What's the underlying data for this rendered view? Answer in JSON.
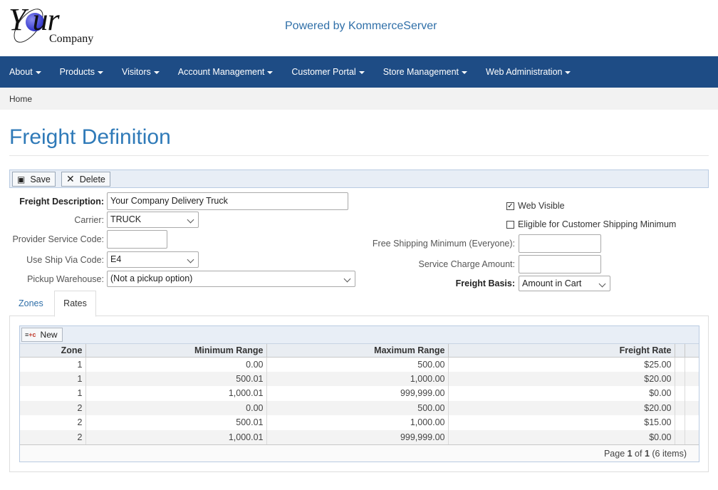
{
  "header": {
    "logo_main": "Y ur",
    "logo_sub": "Company",
    "powered_by": "Powered by KommerceServer"
  },
  "nav": {
    "items": [
      {
        "label": "About"
      },
      {
        "label": "Products"
      },
      {
        "label": "Visitors"
      },
      {
        "label": "Account Management"
      },
      {
        "label": "Customer Portal"
      },
      {
        "label": "Store Management"
      },
      {
        "label": "Web Administration"
      }
    ]
  },
  "breadcrumb": {
    "home": "Home"
  },
  "page": {
    "title": "Freight Definition"
  },
  "toolbar": {
    "save_label": "Save",
    "delete_label": "Delete"
  },
  "form": {
    "freight_description": {
      "label": "Freight Description:",
      "value": "Your Company Delivery Truck"
    },
    "carrier": {
      "label": "Carrier:",
      "value": "TRUCK"
    },
    "provider_service_code": {
      "label": "Provider Service Code:",
      "value": ""
    },
    "use_ship_via_code": {
      "label": "Use Ship Via Code:",
      "value": "E4"
    },
    "pickup_warehouse": {
      "label": "Pickup Warehouse:",
      "value": "(Not a pickup option)"
    },
    "web_visible": {
      "label": "Web Visible",
      "checked": true,
      "check_glyph": "✓"
    },
    "eligible_min": {
      "label": "Eligible for Customer Shipping Minimum",
      "checked": false
    },
    "free_shipping_min": {
      "label": "Free Shipping Minimum (Everyone):",
      "value": ""
    },
    "service_charge": {
      "label": "Service Charge Amount:",
      "value": ""
    },
    "freight_basis": {
      "label": "Freight Basis:",
      "value": "Amount in Cart"
    }
  },
  "tabs": {
    "zones": "Zones",
    "rates": "Rates"
  },
  "grid": {
    "new_label": "New",
    "new_icon_text": "≡",
    "new_icon_sub": "+c",
    "headers": {
      "zone": "Zone",
      "min": "Minimum Range",
      "max": "Maximum Range",
      "rate": "Freight Rate"
    },
    "rows": [
      {
        "zone": "1",
        "min": "0.00",
        "max": "500.00",
        "rate": "$25.00"
      },
      {
        "zone": "1",
        "min": "500.01",
        "max": "1,000.00",
        "rate": "$20.00"
      },
      {
        "zone": "1",
        "min": "1,000.01",
        "max": "999,999.00",
        "rate": "$0.00"
      },
      {
        "zone": "2",
        "min": "0.00",
        "max": "500.00",
        "rate": "$20.00"
      },
      {
        "zone": "2",
        "min": "500.01",
        "max": "1,000.00",
        "rate": "$15.00"
      },
      {
        "zone": "2",
        "min": "1,000.01",
        "max": "999,999.00",
        "rate": "$0.00"
      }
    ],
    "pager": {
      "prefix": "Page ",
      "current": "1",
      "of": " of ",
      "total": "1",
      "suffix": " (6 items)"
    }
  }
}
